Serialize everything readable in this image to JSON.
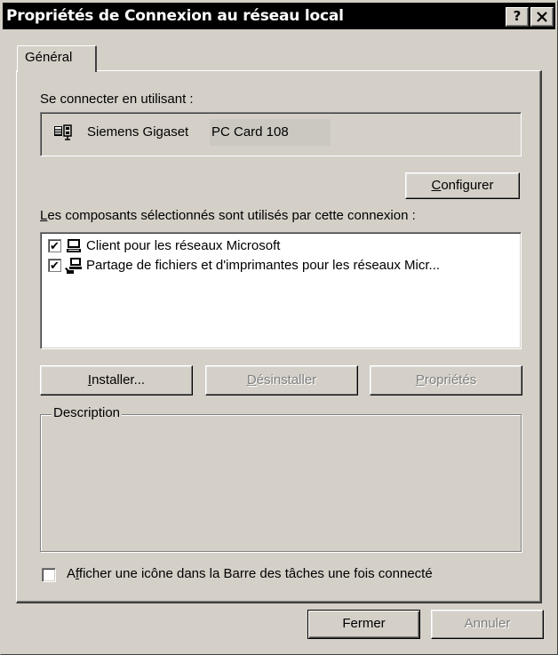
{
  "window": {
    "title": "Propriétés de Connexion au réseau local",
    "help_label": "?",
    "close_label": "✕"
  },
  "tabs": [
    {
      "label": "Général"
    }
  ],
  "connect": {
    "label": "Se connecter en utilisant :",
    "adapter_name_a": "Siemens Gigaset",
    "adapter_name_b": "PC Card 108"
  },
  "configure_button": {
    "mnemonic": "C",
    "rest": "onfigurer"
  },
  "components": {
    "label_mnemonic": "L",
    "label_rest": "es composants sélectionnés sont utilisés par cette connexion :",
    "items": [
      {
        "label": "Client pour les réseaux Microsoft",
        "checked": true,
        "icon": "network-client-icon"
      },
      {
        "label": "Partage de fichiers et d'imprimantes pour les réseaux Micr...",
        "checked": true,
        "icon": "file-printer-sharing-icon"
      }
    ]
  },
  "buttons": {
    "install": {
      "mnemonic": "I",
      "rest": "nstaller..."
    },
    "uninstall": {
      "mnemonic": "D",
      "rest": "ésinstaller"
    },
    "properties": {
      "mnemonic": "P",
      "rest": "ropriétés"
    }
  },
  "description": {
    "legend": "Description",
    "text": ""
  },
  "taskbar_checkbox": {
    "pre": "A",
    "mnemonic": "f",
    "rest": "ficher une icône dans la Barre des tâches une fois connecté",
    "checked": false
  },
  "footer": {
    "close_label": "Fermer",
    "cancel_label": "Annuler"
  },
  "colors": {
    "face": "#d4d0c8",
    "title_bar": "#000000",
    "title_text": "#ffffff"
  }
}
